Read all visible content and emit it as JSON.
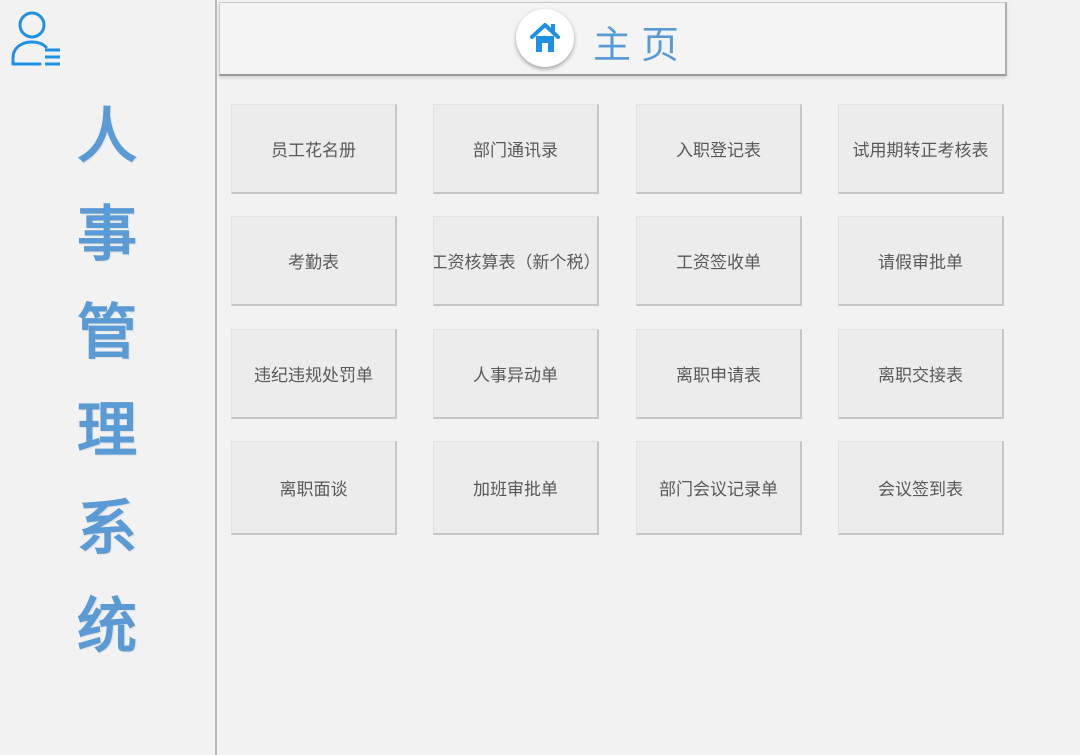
{
  "sidebar": {
    "title_chars": [
      "人",
      "事",
      "管",
      "理",
      "系",
      "统"
    ],
    "icon": "user-list-icon"
  },
  "header": {
    "title": "主页",
    "icon": "home-icon"
  },
  "tiles": [
    "员工花名册",
    "部门通讯录",
    "入职登记表",
    "试用期转正考核表",
    "考勤表",
    "工资核算表（新个税）",
    "工资签收单",
    "请假审批单",
    "违纪违规处罚单",
    "人事异动单",
    "离职申请表",
    "离职交接表",
    "离职面谈",
    "加班审批单",
    "部门会议记录单",
    "会议签到表"
  ],
  "colors": {
    "accent": "#5b9bd5",
    "home_icon": "#1e90e6",
    "background": "#f2f2f2",
    "tile": "#ececec",
    "tile_text": "#595959"
  }
}
